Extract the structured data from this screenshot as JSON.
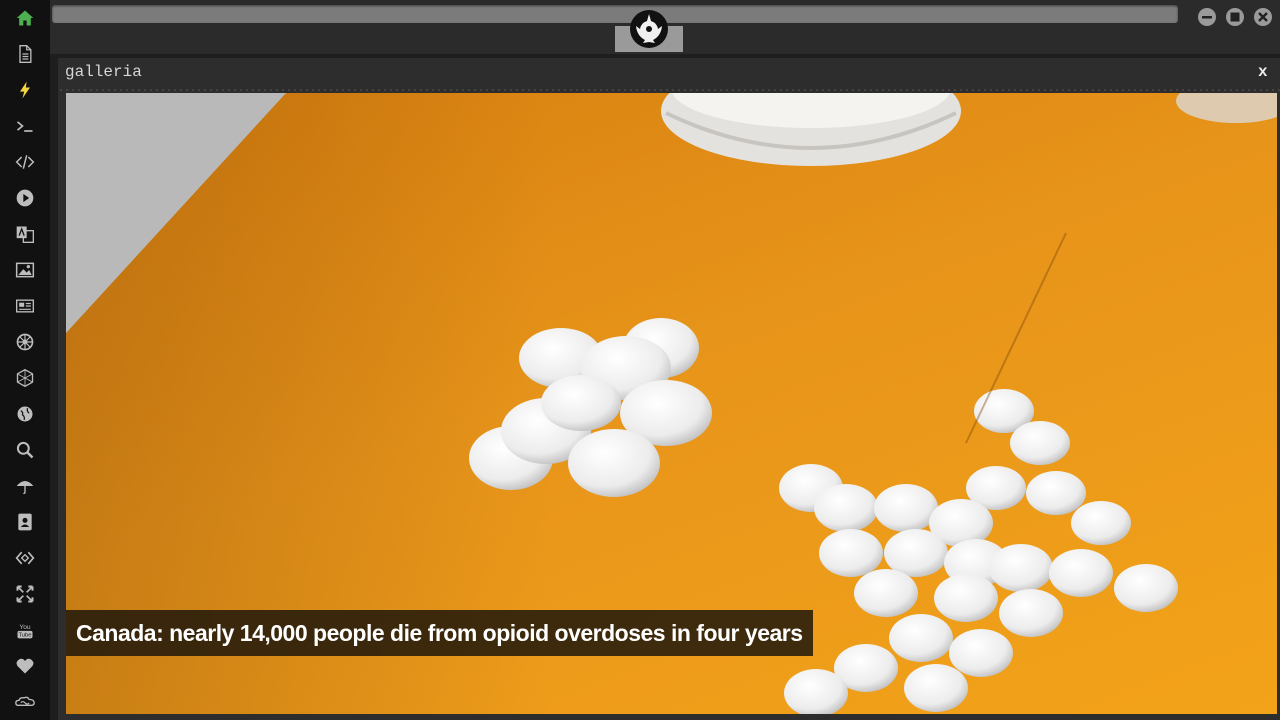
{
  "sidebar": {
    "icons": [
      {
        "name": "home-icon",
        "color": "#4caf50"
      },
      {
        "name": "document-icon",
        "color": "#bdbdbd"
      },
      {
        "name": "lightning-icon",
        "color": "#f5d442"
      },
      {
        "name": "terminal-icon",
        "color": "#bdbdbd"
      },
      {
        "name": "code-icon",
        "color": "#bdbdbd"
      },
      {
        "name": "play-icon",
        "color": "#bdbdbd"
      },
      {
        "name": "translate-icon",
        "color": "#bdbdbd"
      },
      {
        "name": "image-icon",
        "color": "#bdbdbd"
      },
      {
        "name": "newspaper-icon",
        "color": "#bdbdbd"
      },
      {
        "name": "empire-icon",
        "color": "#bdbdbd"
      },
      {
        "name": "hexagon-network-icon",
        "color": "#bdbdbd"
      },
      {
        "name": "globe-icon",
        "color": "#bdbdbd"
      },
      {
        "name": "search-icon",
        "color": "#bdbdbd"
      },
      {
        "name": "umbrella-icon",
        "color": "#bdbdbd"
      },
      {
        "name": "address-book-icon",
        "color": "#bdbdbd"
      },
      {
        "name": "code-diamond-icon",
        "color": "#bdbdbd"
      },
      {
        "name": "expand-icon",
        "color": "#bdbdbd"
      },
      {
        "name": "youtube-icon",
        "color": "#bdbdbd"
      },
      {
        "name": "heart-icon",
        "color": "#bdbdbd"
      },
      {
        "name": "infinity-cloud-icon",
        "color": "#bdbdbd"
      }
    ]
  },
  "window": {
    "emblem": "rebel-alliance-icon",
    "controls": [
      "minimize-icon",
      "maximize-icon",
      "close-icon"
    ]
  },
  "panel": {
    "title": "galleria",
    "close_label": "x"
  },
  "gallery": {
    "caption": "Canada: nearly 14,000 people die from opioid overdoses in four years"
  },
  "colors": {
    "accent_green": "#4caf50",
    "accent_yellow": "#f5d442",
    "background_orange": "#e7941a"
  }
}
